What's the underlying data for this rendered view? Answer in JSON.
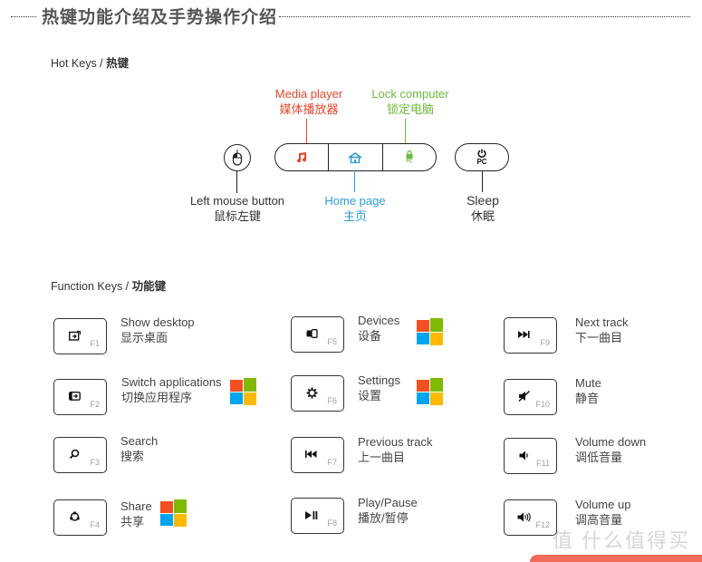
{
  "header": {
    "title": "热键功能介绍及手势操作介绍"
  },
  "hotkeys": {
    "section_en": "Hot Keys / ",
    "section_cn": "热键",
    "left_mouse": {
      "en": "Left mouse button",
      "cn": "鼠标左键",
      "icon": "mouse-icon"
    },
    "media": {
      "en": "Media player",
      "cn": "媒体播放器",
      "icon": "music-note-icon",
      "color": "#e8472a"
    },
    "home": {
      "en": "Home page",
      "cn": "主页",
      "icon": "home-icon",
      "color": "#2e9bd6"
    },
    "lock": {
      "en": "Lock computer",
      "cn": "锁定电脑",
      "icon": "lock-icon",
      "sub": "PC",
      "color": "#6cba3a"
    },
    "sleep": {
      "en": "Sleep",
      "cn": "休眠",
      "icon": "power-icon",
      "sub": "PC"
    }
  },
  "fkeys": {
    "section_en": "Function Keys / ",
    "section_cn": "功能键",
    "items": [
      {
        "key": "F1",
        "en": "Show desktop",
        "cn": "显示桌面",
        "icon": "show-desktop-icon",
        "windows": false
      },
      {
        "key": "F2",
        "en": "Switch applications",
        "cn": "切换应用程序",
        "icon": "switch-apps-icon",
        "windows": true
      },
      {
        "key": "F3",
        "en": "Search",
        "cn": "搜索",
        "icon": "search-icon",
        "windows": false
      },
      {
        "key": "F4",
        "en": "Share",
        "cn": "共享",
        "icon": "share-icon",
        "windows": true
      },
      {
        "key": "F5",
        "en": "Devices",
        "cn": "设备",
        "icon": "devices-icon",
        "windows": true
      },
      {
        "key": "F6",
        "en": "Settings",
        "cn": "设置",
        "icon": "gear-icon",
        "windows": true
      },
      {
        "key": "F7",
        "en": "Previous track",
        "cn": "上一曲目",
        "icon": "previous-track-icon",
        "windows": false
      },
      {
        "key": "F8",
        "en": "Play/Pause",
        "cn": "播放/暂停",
        "icon": "play-pause-icon",
        "windows": false
      },
      {
        "key": "F9",
        "en": "Next track",
        "cn": "下一曲目",
        "icon": "next-track-icon",
        "windows": false
      },
      {
        "key": "F10",
        "en": "Mute",
        "cn": "静音",
        "icon": "mute-icon",
        "windows": false
      },
      {
        "key": "F11",
        "en": "Volume down",
        "cn": "调低音量",
        "icon": "volume-down-icon",
        "windows": false
      },
      {
        "key": "F12",
        "en": "Volume up",
        "cn": "调高音量",
        "icon": "volume-up-icon",
        "windows": false
      }
    ]
  },
  "windows_logo_colors": [
    "#f25022",
    "#7fba00",
    "#00a4ef",
    "#ffb900"
  ],
  "watermark": {
    "text": "值 什么值得买"
  }
}
